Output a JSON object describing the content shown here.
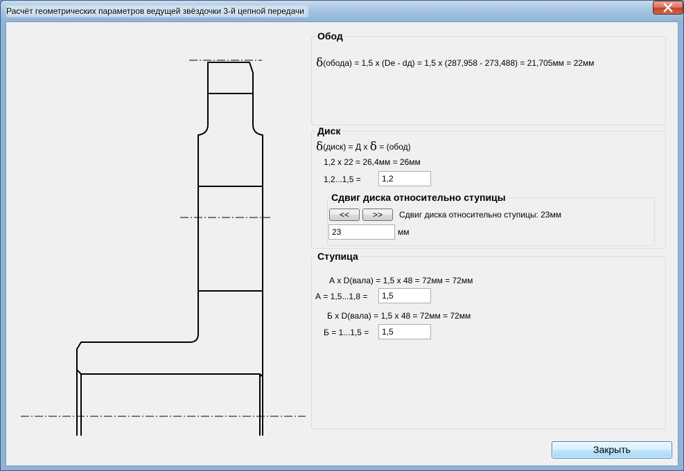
{
  "window": {
    "title": "Расчёт геометрических параметров ведущей звёздочки 3-й цепной передачи"
  },
  "obod": {
    "title": "Обод",
    "delta_symbol": "δ",
    "formula": "(обода) = 1,5 х (De - dд) = 1,5 х (287,958 - 273,488) = 21,705мм = 22мм"
  },
  "disk": {
    "title": "Диск",
    "delta1": "δ",
    "formula_a": "(диск) = Д х",
    "delta2": "δ",
    "formula_b": "= (обод)",
    "calc": "1,2 х 22 = 26,4мм = 26мм",
    "range_label": "1,2...1,5 =",
    "value": "1,2",
    "shift": {
      "title": "Сдвиг диска относительно ступицы",
      "prev_label": "<<",
      "next_label": ">>",
      "status": "Сдвиг диска относительно ступицы: 23мм",
      "value": "23",
      "unit": "мм"
    }
  },
  "hub": {
    "title": "Ступица",
    "formula_a": "А х D(вала) = 1,5 х 48 = 72мм = 72мм",
    "label_a": "А = 1,5...1,8 =",
    "value_a": "1,5",
    "formula_b": "Б х D(вала) = 1,5 х 48 = 72мм = 72мм",
    "label_b": "Б = 1...1,5 =",
    "value_b": "1,5"
  },
  "close_label": "Закрыть"
}
